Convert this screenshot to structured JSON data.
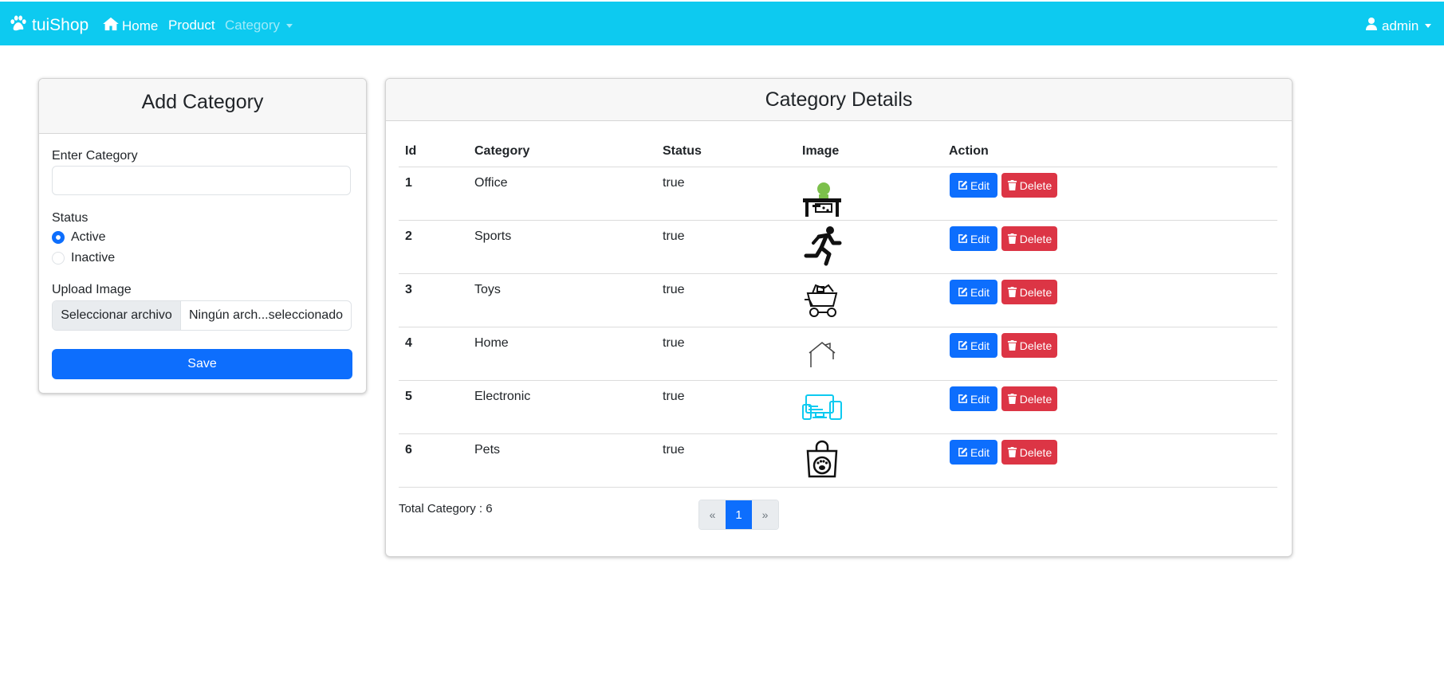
{
  "navbar": {
    "brand": "tuiShop",
    "home": "Home",
    "product": "Product",
    "category": "Category",
    "user": "admin",
    "bg_color": "#0dcaf0"
  },
  "add_form": {
    "title": "Add Category",
    "category_label": "Enter Category",
    "category_value": "",
    "status_label": "Status",
    "status_options": [
      "Active",
      "Inactive"
    ],
    "status_selected": "Active",
    "upload_label": "Upload Image",
    "file_button": "Seleccionar archivo",
    "file_name": "Ningún arch...seleccionado",
    "save_label": "Save"
  },
  "details": {
    "title": "Category Details",
    "columns": [
      "Id",
      "Category",
      "Status",
      "Image",
      "Action"
    ],
    "rows": [
      {
        "id": "1",
        "category": "Office",
        "status": "true",
        "image_icon": "office-desk-icon"
      },
      {
        "id": "2",
        "category": "Sports",
        "status": "true",
        "image_icon": "running-person-icon"
      },
      {
        "id": "3",
        "category": "Toys",
        "status": "true",
        "image_icon": "toy-cart-icon"
      },
      {
        "id": "4",
        "category": "Home",
        "status": "true",
        "image_icon": "house-outline-icon"
      },
      {
        "id": "5",
        "category": "Electronic",
        "status": "true",
        "image_icon": "devices-icon"
      },
      {
        "id": "6",
        "category": "Pets",
        "status": "true",
        "image_icon": "pet-bag-icon"
      }
    ],
    "edit_label": "Edit",
    "delete_label": "Delete",
    "total": "Total Category : 6",
    "pagination": {
      "prev": "«",
      "current": "1",
      "next": "»"
    }
  },
  "colors": {
    "primary": "#0d6efd",
    "danger": "#dc3545",
    "info": "#0dcaf0"
  }
}
